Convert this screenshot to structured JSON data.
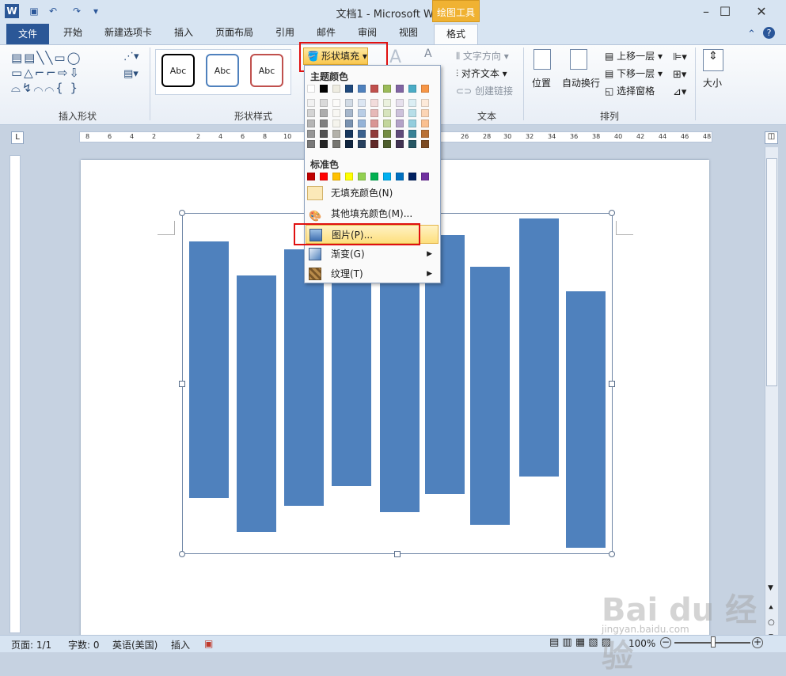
{
  "title": "文档1 - Microsoft Word",
  "context_tools": "绘图工具",
  "window": {
    "minimize": "–",
    "maximize": "☐",
    "close": "✕"
  },
  "qat": {
    "word_icon": "W",
    "save_icon": "save-icon",
    "undo_icon": "undo-icon",
    "redo_icon": "redo-icon"
  },
  "tabs": [
    "开始",
    "新建选项卡",
    "插入",
    "页面布局",
    "引用",
    "邮件",
    "审阅",
    "视图"
  ],
  "file_tab": "文件",
  "format_tab": "格式",
  "ribbon": {
    "insert_shapes_label": "插入形状",
    "shape_styles_label": "形状样式",
    "text_label": "文本",
    "arrange_label": "排列",
    "abc_samples": [
      "Abc",
      "Abc",
      "Abc"
    ],
    "fill_button": "形状填充",
    "text_direction": "文字方向",
    "align_text": "对齐文本",
    "create_link": "创建链接",
    "position": "位置",
    "wrap_text": "自动换行",
    "bring_forward": "上移一层",
    "send_backward": "下移一层",
    "selection_pane": "选择窗格",
    "size": "大小"
  },
  "menu": {
    "theme_colors_label": "主题颜色",
    "standard_colors_label": "标准色",
    "no_fill": "无填充颜色(N)",
    "more_colors": "其他填充颜色(M)...",
    "picture": "图片(P)...",
    "gradient": "渐变(G)",
    "texture": "纹理(T)",
    "theme_top": [
      "#ffffff",
      "#000000",
      "#eeece1",
      "#1f497d",
      "#4f81bd",
      "#c0504d",
      "#9bbb59",
      "#8064a2",
      "#4bacc6",
      "#f79646"
    ],
    "standard": [
      "#c00000",
      "#ff0000",
      "#ffc000",
      "#ffff00",
      "#92d050",
      "#00b050",
      "#00b0f0",
      "#0070c0",
      "#002060",
      "#7030a0"
    ]
  },
  "ruler_numbers": [
    "8",
    "6",
    "4",
    "2",
    "2",
    "4",
    "6",
    "8",
    "10",
    "26",
    "28",
    "30",
    "32",
    "34",
    "36",
    "38",
    "40",
    "42",
    "44",
    "46",
    "48"
  ],
  "chart_data": {
    "type": "bar",
    "values_top": [
      305,
      348,
      315,
      355,
      358,
      297,
      337,
      276,
      368
    ],
    "values_bottom": [
      629,
      672,
      639,
      614,
      647,
      624,
      663,
      602,
      692
    ],
    "color": "#4f81bd"
  },
  "status": {
    "page": "页面: 1/1",
    "words": "字数: 0",
    "language": "英语(美国)",
    "insert_mode": "插入",
    "zoom": "100%"
  },
  "watermark": "Bai du 经验",
  "watermark_url": "jingyan.baidu.com"
}
